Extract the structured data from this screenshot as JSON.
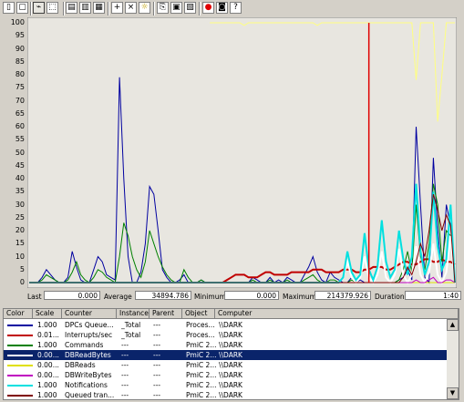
{
  "toolbar": {
    "buttons": [
      {
        "name": "new-counter-set-icon",
        "glyph": "▯"
      },
      {
        "name": "clear-display-icon",
        "glyph": "▢"
      },
      {
        "name": "view-current-activity-icon",
        "glyph": "⌁"
      },
      {
        "name": "view-log-data-icon",
        "glyph": "⬚"
      },
      {
        "name": "view-graph-icon",
        "glyph": "▤"
      },
      {
        "name": "view-histogram-icon",
        "glyph": "▥"
      },
      {
        "name": "view-report-icon",
        "glyph": "▦"
      },
      {
        "name": "add-counter-icon",
        "glyph": "+"
      },
      {
        "name": "delete-counter-icon",
        "glyph": "×"
      },
      {
        "name": "highlight-icon",
        "glyph": "☼"
      },
      {
        "name": "copy-properties-icon",
        "glyph": "⎘"
      },
      {
        "name": "paste-counter-list-icon",
        "glyph": "▣"
      },
      {
        "name": "properties-icon",
        "glyph": "▧"
      },
      {
        "name": "freeze-display-icon",
        "glyph": "●"
      },
      {
        "name": "update-data-icon",
        "glyph": "◙"
      },
      {
        "name": "help-icon",
        "glyph": "?"
      }
    ]
  },
  "chart": {
    "y_ticks": [
      "100",
      "95",
      "90",
      "85",
      "80",
      "75",
      "70",
      "65",
      "60",
      "55",
      "50",
      "45",
      "40",
      "35",
      "30",
      "25",
      "20",
      "15",
      "10",
      "5",
      "0"
    ]
  },
  "chart_data": {
    "type": "line",
    "ylim": [
      0,
      100
    ],
    "n_points": 100,
    "current_position": 79,
    "series": [
      {
        "name": "DPCs Queued/sec",
        "color": "#0000a0",
        "values": [
          0,
          0,
          0,
          2,
          5,
          3,
          1,
          0,
          0,
          2,
          12,
          6,
          1,
          0,
          0,
          5,
          10,
          8,
          3,
          2,
          1,
          79,
          40,
          10,
          0,
          0,
          4,
          15,
          37,
          34,
          20,
          5,
          2,
          0,
          0,
          1,
          3,
          0,
          0,
          0,
          1,
          0,
          0,
          0,
          0,
          0,
          0,
          0,
          0,
          0,
          0,
          0,
          2,
          1,
          0,
          0,
          2,
          0,
          1,
          0,
          2,
          1,
          0,
          0,
          3,
          6,
          10,
          4,
          1,
          0,
          4,
          2,
          1,
          0,
          0,
          2,
          0,
          1,
          0,
          0,
          0,
          0,
          0,
          0,
          0,
          0,
          1,
          2,
          5,
          1,
          60,
          30,
          2,
          0,
          48,
          21,
          2,
          30,
          22,
          0
        ]
      },
      {
        "name": "Interrupts/sec",
        "color": "#c00000",
        "values": [
          0,
          0,
          0,
          0,
          0,
          0,
          0,
          0,
          0,
          0,
          0,
          0,
          0,
          0,
          0,
          0,
          0,
          0,
          0,
          0,
          0,
          0,
          0,
          0,
          0,
          0,
          0,
          0,
          0,
          0,
          0,
          0,
          0,
          0,
          0,
          0,
          0,
          0,
          0,
          0,
          0,
          0,
          0,
          0,
          0,
          0,
          1,
          2,
          3,
          3,
          3,
          2,
          2,
          2,
          3,
          4,
          4,
          3,
          3,
          3,
          3,
          4,
          4,
          4,
          4,
          4,
          5,
          5,
          5,
          4,
          4,
          4,
          4,
          5,
          5,
          5,
          4,
          4,
          5,
          5,
          6,
          6,
          6,
          5,
          5,
          6,
          7,
          8,
          8,
          7,
          7,
          8,
          9,
          9,
          8,
          8,
          9,
          8,
          8,
          7
        ]
      },
      {
        "name": "Commands",
        "color": "#008000",
        "values": [
          0,
          0,
          0,
          1,
          3,
          2,
          1,
          0,
          0,
          1,
          4,
          8,
          3,
          1,
          0,
          2,
          5,
          4,
          2,
          1,
          0,
          10,
          23,
          18,
          10,
          5,
          2,
          8,
          20,
          15,
          10,
          6,
          3,
          1,
          0,
          0,
          5,
          2,
          0,
          0,
          1,
          0,
          0,
          0,
          0,
          0,
          0,
          0,
          0,
          0,
          0,
          0,
          1,
          0,
          0,
          0,
          1,
          0,
          0,
          0,
          1,
          0,
          0,
          0,
          1,
          2,
          3,
          1,
          0,
          0,
          1,
          1,
          0,
          0,
          0,
          1,
          0,
          0,
          0,
          0,
          0,
          0,
          0,
          0,
          0,
          0,
          1,
          5,
          12,
          4,
          30,
          10,
          5,
          15,
          38,
          30,
          8,
          20,
          18,
          0
        ]
      },
      {
        "name": "DBReadBytes",
        "color": "#ffffff",
        "values": [
          0,
          0,
          0,
          0,
          0,
          0,
          0,
          0,
          0,
          0,
          0,
          0,
          0,
          0,
          0,
          0,
          0,
          0,
          0,
          0,
          0,
          0,
          0,
          0,
          0,
          0,
          0,
          0,
          0,
          0,
          0,
          0,
          0,
          0,
          0,
          0,
          0,
          0,
          0,
          0,
          0,
          0,
          0,
          0,
          0,
          0,
          0,
          0,
          0,
          0,
          0,
          0,
          0,
          0,
          0,
          0,
          0,
          0,
          0,
          0,
          0,
          0,
          0,
          0,
          0,
          0,
          0,
          0,
          0,
          0,
          0,
          0,
          0,
          2,
          8,
          2,
          0,
          2,
          10,
          2,
          0,
          3,
          12,
          2,
          0,
          3,
          13,
          3,
          0,
          3,
          14,
          3,
          0,
          4,
          15,
          3,
          0,
          4,
          18,
          0
        ]
      },
      {
        "name": "DBReads",
        "color": "#e0e000",
        "values": [
          0,
          0,
          0,
          0,
          0,
          0,
          0,
          0,
          0,
          0,
          0,
          0,
          0,
          0,
          0,
          0,
          0,
          0,
          0,
          0,
          0,
          0,
          0,
          0,
          0,
          0,
          0,
          0,
          0,
          0,
          0,
          0,
          0,
          0,
          0,
          0,
          0,
          0,
          0,
          0,
          0,
          0,
          0,
          0,
          0,
          0,
          0,
          0,
          0,
          0,
          0,
          0,
          0,
          0,
          0,
          0,
          0,
          0,
          0,
          0,
          0,
          0,
          0,
          0,
          0,
          0,
          0,
          0,
          0,
          0,
          0,
          0,
          0,
          0,
          0,
          0,
          0,
          0,
          0,
          0,
          0,
          0,
          0,
          0,
          0,
          0,
          0,
          0,
          0,
          0,
          0,
          0,
          0,
          0,
          0,
          0,
          0,
          0,
          0,
          0
        ]
      },
      {
        "name": "DBWriteBytes",
        "color": "#c000c0",
        "values": [
          0,
          0,
          0,
          0,
          0,
          0,
          0,
          0,
          0,
          0,
          0,
          0,
          0,
          0,
          0,
          0,
          0,
          0,
          0,
          0,
          0,
          0,
          0,
          0,
          0,
          0,
          0,
          0,
          0,
          0,
          0,
          0,
          0,
          0,
          0,
          0,
          0,
          0,
          0,
          0,
          0,
          0,
          0,
          0,
          0,
          0,
          0,
          0,
          0,
          0,
          0,
          0,
          0,
          0,
          0,
          0,
          0,
          0,
          0,
          0,
          0,
          0,
          0,
          0,
          0,
          0,
          0,
          0,
          0,
          0,
          0,
          0,
          0,
          0,
          0,
          0,
          0,
          0,
          0,
          0,
          0,
          0,
          0,
          0,
          0,
          0,
          0,
          0,
          0,
          0,
          1,
          0,
          0,
          1,
          2,
          0,
          0,
          1,
          1,
          0
        ]
      },
      {
        "name": "Notifications",
        "color": "#00e0e0",
        "values": [
          0,
          0,
          0,
          0,
          0,
          0,
          0,
          0,
          0,
          0,
          0,
          0,
          0,
          0,
          0,
          0,
          0,
          0,
          0,
          0,
          0,
          0,
          0,
          0,
          0,
          0,
          0,
          0,
          0,
          0,
          0,
          0,
          0,
          0,
          0,
          0,
          0,
          0,
          0,
          0,
          0,
          0,
          0,
          0,
          0,
          0,
          0,
          0,
          0,
          0,
          0,
          0,
          0,
          0,
          0,
          0,
          0,
          0,
          0,
          0,
          0,
          0,
          0,
          0,
          0,
          0,
          0,
          0,
          0,
          0,
          0,
          0,
          0,
          2,
          12,
          4,
          1,
          3,
          19,
          5,
          1,
          6,
          24,
          8,
          2,
          5,
          20,
          9,
          3,
          10,
          38,
          12,
          3,
          8,
          35,
          14,
          5,
          9,
          30,
          0
        ]
      },
      {
        "name": "Queued transactions",
        "color": "#800000",
        "values": [
          0,
          0,
          0,
          0,
          0,
          0,
          0,
          0,
          0,
          0,
          0,
          0,
          0,
          0,
          0,
          0,
          0,
          0,
          0,
          0,
          0,
          0,
          0,
          0,
          0,
          0,
          0,
          0,
          0,
          0,
          0,
          0,
          0,
          0,
          0,
          0,
          0,
          0,
          0,
          0,
          0,
          0,
          0,
          0,
          0,
          0,
          0,
          0,
          0,
          0,
          0,
          0,
          0,
          0,
          0,
          0,
          0,
          0,
          0,
          0,
          0,
          0,
          0,
          0,
          0,
          0,
          0,
          0,
          0,
          0,
          0,
          0,
          0,
          0,
          0,
          0,
          0,
          0,
          0,
          0,
          0,
          0,
          0,
          0,
          0,
          0,
          0,
          2,
          6,
          3,
          8,
          15,
          10,
          20,
          34,
          28,
          20,
          26,
          22,
          0
        ]
      },
      {
        "name": "Processor Time (white overlay)",
        "color": "#ffff80",
        "values": [
          null,
          null,
          null,
          null,
          null,
          null,
          null,
          null,
          null,
          null,
          null,
          null,
          null,
          null,
          null,
          null,
          null,
          null,
          null,
          null,
          null,
          null,
          null,
          null,
          null,
          null,
          null,
          null,
          null,
          null,
          null,
          null,
          null,
          null,
          null,
          null,
          null,
          null,
          null,
          null,
          null,
          null,
          100,
          100,
          100,
          100,
          100,
          100,
          100,
          100,
          99,
          100,
          100,
          100,
          100,
          100,
          100,
          100,
          100,
          100,
          100,
          100,
          100,
          100,
          100,
          100,
          100,
          99,
          100,
          100,
          100,
          100,
          100,
          100,
          100,
          100,
          100,
          100,
          100,
          100,
          100,
          100,
          100,
          100,
          100,
          100,
          100,
          100,
          100,
          100,
          78,
          100,
          100,
          100,
          100,
          62,
          80,
          100,
          100,
          100
        ]
      }
    ]
  },
  "stats": {
    "last_label": "Last",
    "last_value": "0.000",
    "average_label": "Average",
    "average_value": "34894.786",
    "minimum_label": "Minimum",
    "minimum_value": "0.000",
    "maximum_label": "Maximum",
    "maximum_value": "214379.926",
    "duration_label": "Duration",
    "duration_value": "1:40"
  },
  "legend": {
    "headers": [
      "Color",
      "Scale",
      "Counter",
      "Instance",
      "Parent",
      "Object",
      "Computer"
    ],
    "rows": [
      {
        "color": "#0000a0",
        "scale": "1.000",
        "counter": "DPCs Queue...",
        "instance": "_Total",
        "parent": "---",
        "object": "Proces...",
        "computer": "\\\\DARK"
      },
      {
        "color": "#c00000",
        "scale": "0.01...",
        "counter": "Interrupts/sec",
        "instance": "_Total",
        "parent": "---",
        "object": "Proces...",
        "computer": "\\\\DARK"
      },
      {
        "color": "#008000",
        "scale": "1.000",
        "counter": "Commands",
        "instance": "---",
        "parent": "---",
        "object": "PmiC 2...",
        "computer": "\\\\DARK"
      },
      {
        "color": "#ffffff",
        "scale": "0.00...",
        "counter": "DBReadBytes",
        "instance": "---",
        "parent": "---",
        "object": "PmiC 2...",
        "computer": "\\\\DARK",
        "selected": true
      },
      {
        "color": "#e0e000",
        "scale": "0.00...",
        "counter": "DBReads",
        "instance": "---",
        "parent": "---",
        "object": "PmiC 2...",
        "computer": "\\\\DARK"
      },
      {
        "color": "#c000c0",
        "scale": "0.00...",
        "counter": "DBWriteBytes",
        "instance": "---",
        "parent": "---",
        "object": "PmiC 2...",
        "computer": "\\\\DARK"
      },
      {
        "color": "#00e0e0",
        "scale": "1.000",
        "counter": "Notifications",
        "instance": "---",
        "parent": "---",
        "object": "PmiC 2...",
        "computer": "\\\\DARK"
      },
      {
        "color": "#800000",
        "scale": "1.000",
        "counter": "Queued tran...",
        "instance": "---",
        "parent": "---",
        "object": "PmiC 2...",
        "computer": "\\\\DARK"
      }
    ],
    "scroll_up_glyph": "▲",
    "scroll_down_glyph": "▼"
  }
}
